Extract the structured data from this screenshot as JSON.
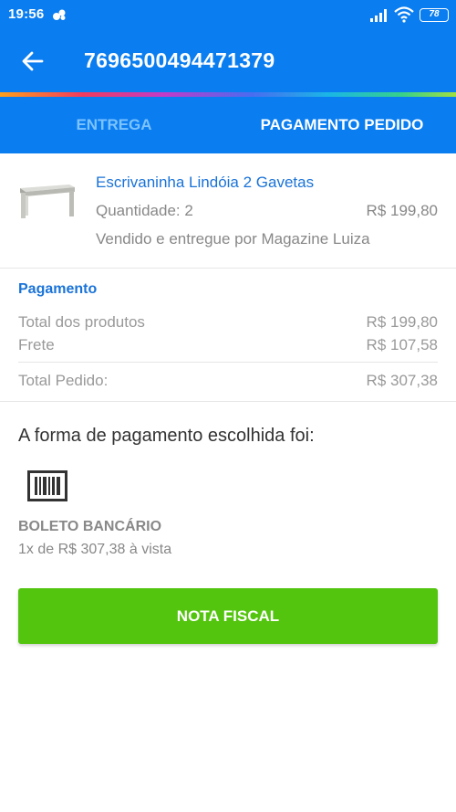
{
  "statusbar": {
    "time": "19:56",
    "battery": "78"
  },
  "header": {
    "order_number": "7696500494471379"
  },
  "tabs": [
    {
      "label": "ENTREGA",
      "active": false
    },
    {
      "label": "PAGAMENTO PEDIDO",
      "active": true
    }
  ],
  "product": {
    "name": "Escrivaninha Lindóia 2 Gavetas",
    "quantity": "Quantidade: 2",
    "price": "R$ 199,80",
    "seller": "Vendido e entregue por Magazine Luiza"
  },
  "payment": {
    "heading": "Pagamento",
    "rows": [
      {
        "label": "Total dos produtos",
        "value": "R$ 199,80"
      },
      {
        "label": "Frete",
        "value": "R$ 107,58"
      },
      {
        "label": "Total Pedido:",
        "value": "R$ 307,38"
      }
    ]
  },
  "method": {
    "label": "A forma de pagamento escolhida foi:",
    "icon": "barcode-icon",
    "type": "BOLETO BANCÁRIO",
    "terms": "1x de R$ 307,38 à vista"
  },
  "actions": {
    "nota_fiscal": "NOTA FISCAL"
  },
  "colors": {
    "primary": "#0a7df0",
    "accent_blue": "#1a73d8",
    "button_green": "#54c50f"
  }
}
